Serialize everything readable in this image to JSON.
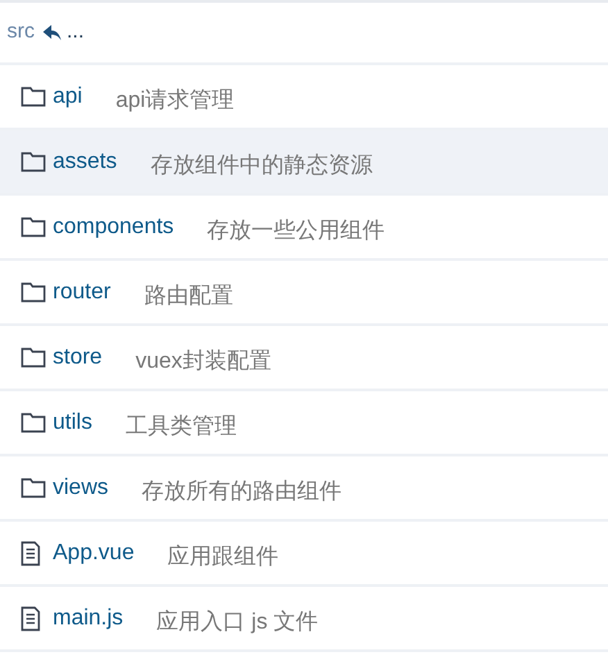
{
  "breadcrumb": {
    "path": "src",
    "ellipsis": "..."
  },
  "entries": [
    {
      "kind": "folder",
      "name": "api",
      "comment": "api请求管理",
      "selected": false
    },
    {
      "kind": "folder",
      "name": "assets",
      "comment": "存放组件中的静态资源",
      "selected": true
    },
    {
      "kind": "folder",
      "name": "components",
      "comment": "存放一些公用组件",
      "selected": false
    },
    {
      "kind": "folder",
      "name": "router",
      "comment": "路由配置",
      "selected": false
    },
    {
      "kind": "folder",
      "name": "store",
      "comment": "vuex封装配置",
      "selected": false
    },
    {
      "kind": "folder",
      "name": "utils",
      "comment": "工具类管理",
      "selected": false
    },
    {
      "kind": "folder",
      "name": "views",
      "comment": "存放所有的路由组件",
      "selected": false
    },
    {
      "kind": "file",
      "name": "App.vue",
      "comment": "应用跟组件",
      "selected": false
    },
    {
      "kind": "file",
      "name": "main.js",
      "comment": "应用入口 js 文件",
      "selected": false
    }
  ]
}
